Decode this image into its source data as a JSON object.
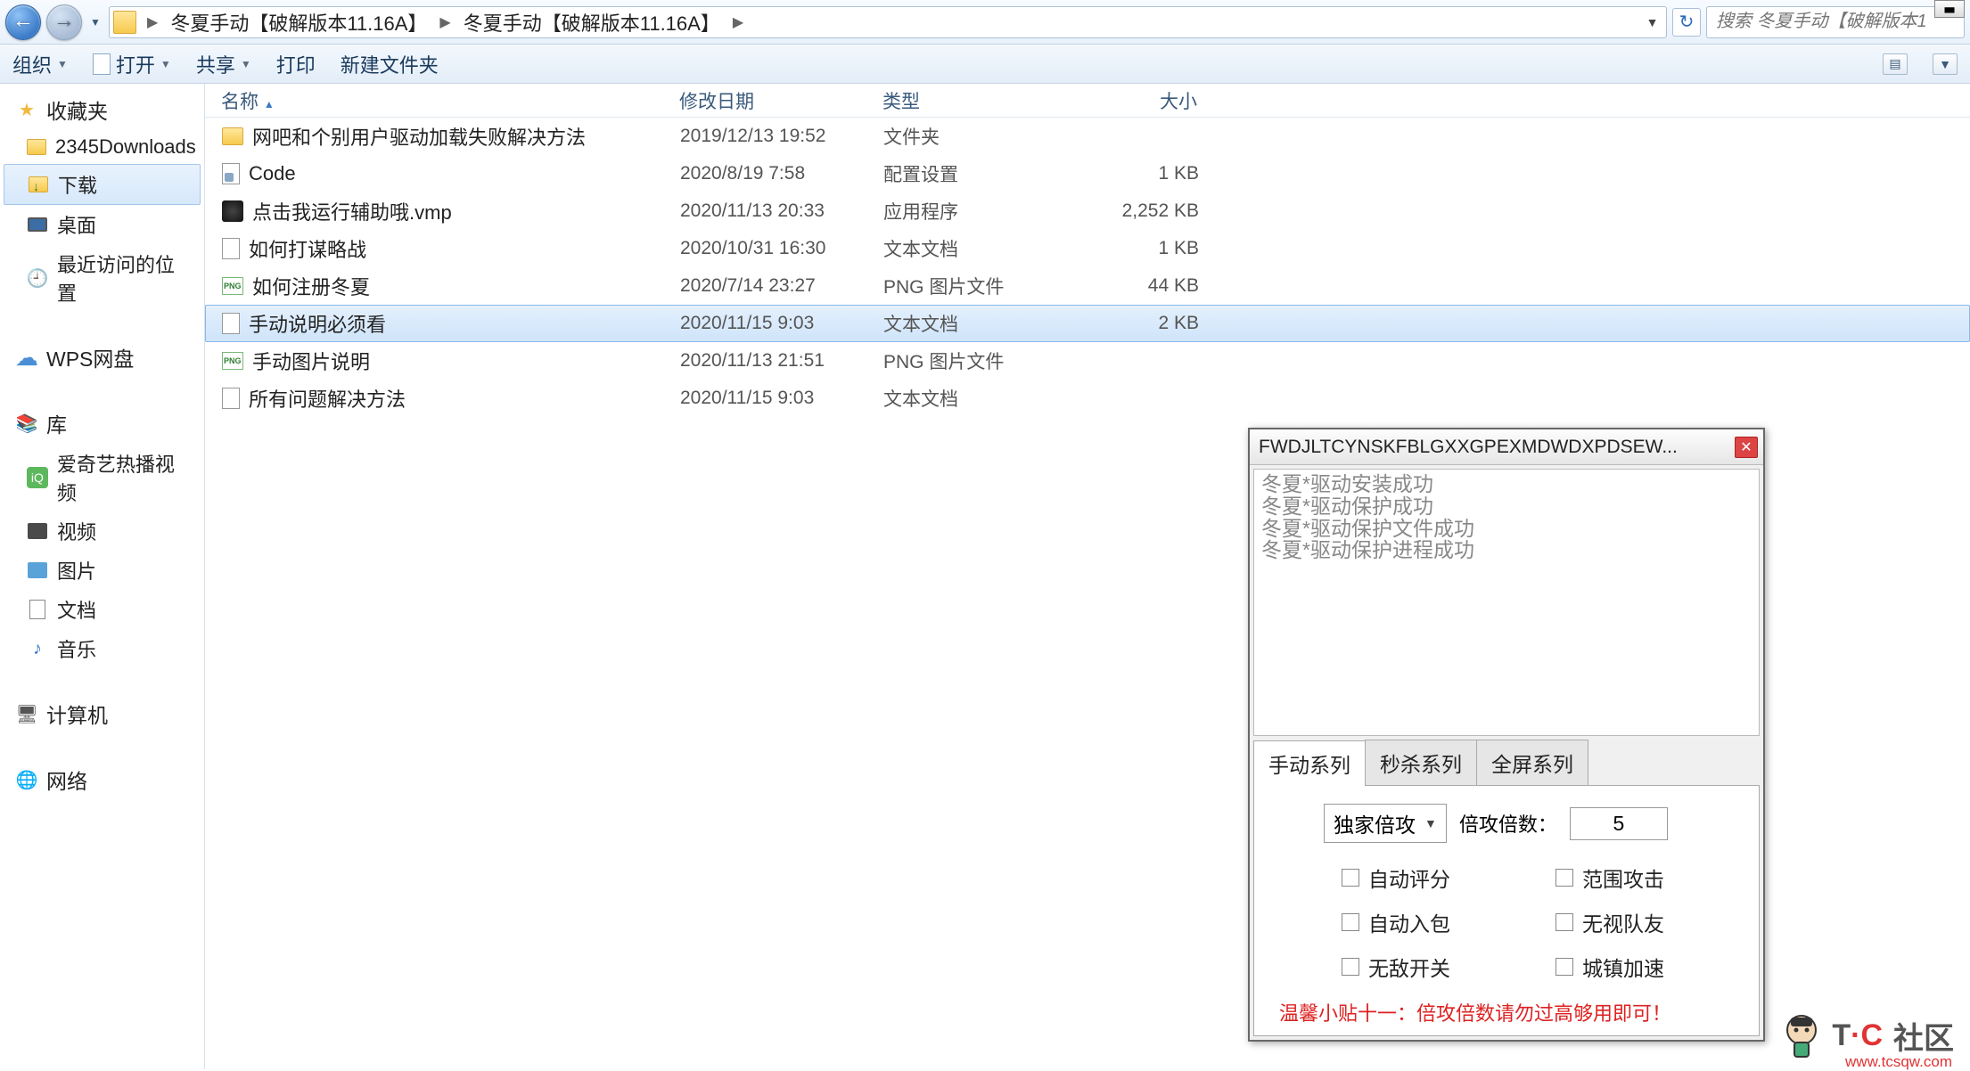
{
  "breadcrumb": {
    "seg1": "冬夏手动【破解版本11.16A】",
    "seg2": "冬夏手动【破解版本11.16A】"
  },
  "search": {
    "placeholder": "搜索 冬夏手动【破解版本1"
  },
  "toolbar": {
    "organize": "组织",
    "open": "打开",
    "share": "共享",
    "print": "打印",
    "newfolder": "新建文件夹"
  },
  "sidebar": {
    "favorites": "收藏夹",
    "downloads2345": "2345Downloads",
    "downloads": "下载",
    "desktop": "桌面",
    "recent": "最近访问的位置",
    "wps": "WPS网盘",
    "library": "库",
    "iqiyi": "爱奇艺热播视频",
    "video": "视频",
    "pictures": "图片",
    "documents": "文档",
    "music": "音乐",
    "computer": "计算机",
    "network": "网络"
  },
  "columns": {
    "name": "名称",
    "date": "修改日期",
    "type": "类型",
    "size": "大小"
  },
  "files": [
    {
      "icon": "folder",
      "name": "网吧和个别用户驱动加载失败解决方法",
      "date": "2019/12/13 19:52",
      "type": "文件夹",
      "size": ""
    },
    {
      "icon": "ini",
      "name": "Code",
      "date": "2020/8/19 7:58",
      "type": "配置设置",
      "size": "1 KB"
    },
    {
      "icon": "exe",
      "name": "点击我运行辅助哦.vmp",
      "date": "2020/11/13 20:33",
      "type": "应用程序",
      "size": "2,252 KB"
    },
    {
      "icon": "txt",
      "name": "如何打谋略战",
      "date": "2020/10/31 16:30",
      "type": "文本文档",
      "size": "1 KB"
    },
    {
      "icon": "png",
      "name": "如何注册冬夏",
      "date": "2020/7/14 23:27",
      "type": "PNG 图片文件",
      "size": "44 KB"
    },
    {
      "icon": "txt",
      "name": "手动说明必须看",
      "date": "2020/11/15 9:03",
      "type": "文本文档",
      "size": "2 KB",
      "selected": true
    },
    {
      "icon": "png",
      "name": "手动图片说明",
      "date": "2020/11/13 21:51",
      "type": "PNG 图片文件",
      "size": ""
    },
    {
      "icon": "txt",
      "name": "所有问题解决方法",
      "date": "2020/11/15 9:03",
      "type": "文本文档",
      "size": ""
    }
  ],
  "toolwin": {
    "title": "FWDJLTCYNSKFBLGXXGPEXMDWDXPDSEW...",
    "log": "冬夏*驱动安装成功\n冬夏*驱动保护成功\n冬夏*驱动保护文件成功\n冬夏*驱动保护进程成功",
    "tabs": {
      "t1": "手动系列",
      "t2": "秒杀系列",
      "t3": "全屏系列"
    },
    "select_label": "独家倍攻",
    "mult_label": "倍攻倍数：",
    "mult_value": "5",
    "checks": {
      "c1": "自动评分",
      "c2": "范围攻击",
      "c3": "自动入包",
      "c4": "无视队友",
      "c5": "无敌开关",
      "c6": "城镇加速"
    },
    "tip": "温馨小贴十一：倍攻倍数请勿过高够用即可！"
  },
  "watermark": {
    "tc": "T·C",
    "label": "社区",
    "url": "www.tcsqw.com"
  }
}
